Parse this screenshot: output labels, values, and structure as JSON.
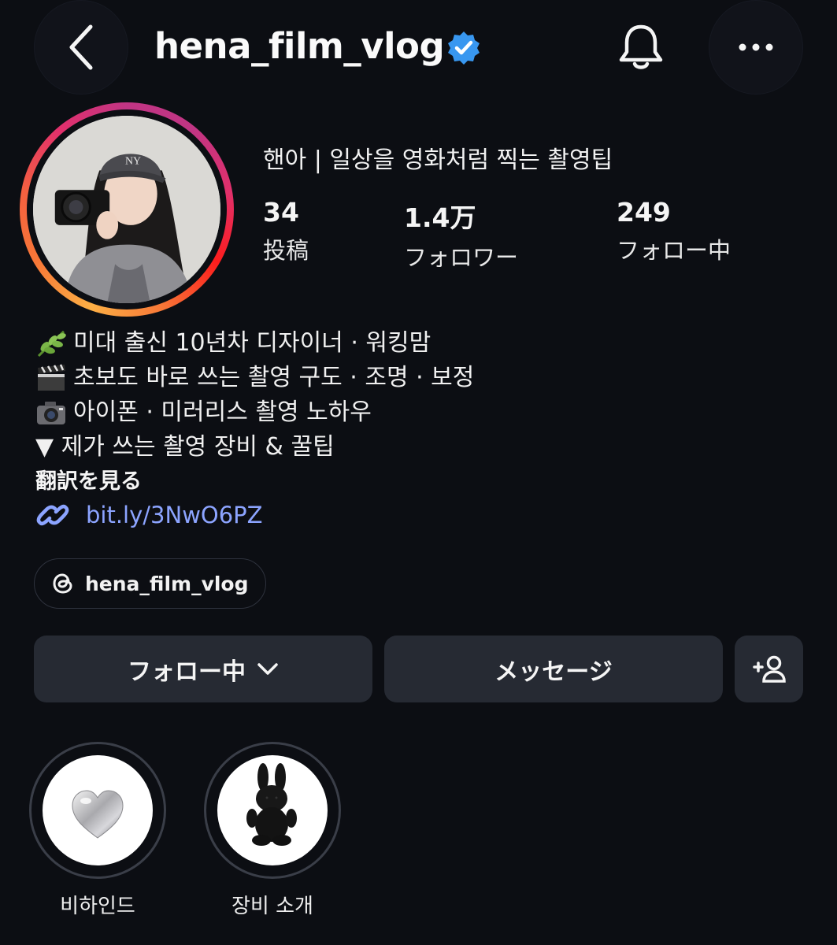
{
  "header": {
    "username": "hena_film_vlog",
    "verified": true,
    "icons": {
      "back": "chevron-left-icon",
      "bell": "bell-icon",
      "more": "more-horizontal-icon"
    }
  },
  "profile": {
    "display_name": "핸아 | 일상을 영화처럼 찍는 촬영팁",
    "stats": {
      "posts": {
        "value": "34",
        "label": "投稿"
      },
      "followers": {
        "value": "1.4万",
        "label": "フォロワー"
      },
      "following": {
        "value": "249",
        "label": "フォロー中"
      }
    }
  },
  "bio": {
    "lines": [
      {
        "emoji": "herb-icon",
        "text": "미대 출신 10년차 디자이너 · 워킹맘"
      },
      {
        "emoji": "clapperboard-icon",
        "text": "초보도 바로 쓰는 촬영 구도 · 조명 · 보정"
      },
      {
        "emoji": "camera-icon",
        "text": "아이폰 · 미러리스 촬영 노하우"
      },
      {
        "emoji": "",
        "text": "▼ 제가 쓰는 촬영 장비 & 꿀팁"
      }
    ],
    "translate_label": "翻訳を見る",
    "link": "bit.ly/3NwO6PZ"
  },
  "threads_chip": {
    "label": "hena_film_vlog"
  },
  "actions": {
    "follow_label": "フォロー中",
    "message_label": "メッセージ"
  },
  "highlights": [
    {
      "label": "비하인드",
      "icon": "silver-heart-icon"
    },
    {
      "label": "장비 소개",
      "icon": "black-bunny-plush-icon"
    }
  ],
  "colors": {
    "background": "#0c0e13",
    "button": "#262a33",
    "link": "#8ca4ff",
    "verified": "#3897f0"
  }
}
